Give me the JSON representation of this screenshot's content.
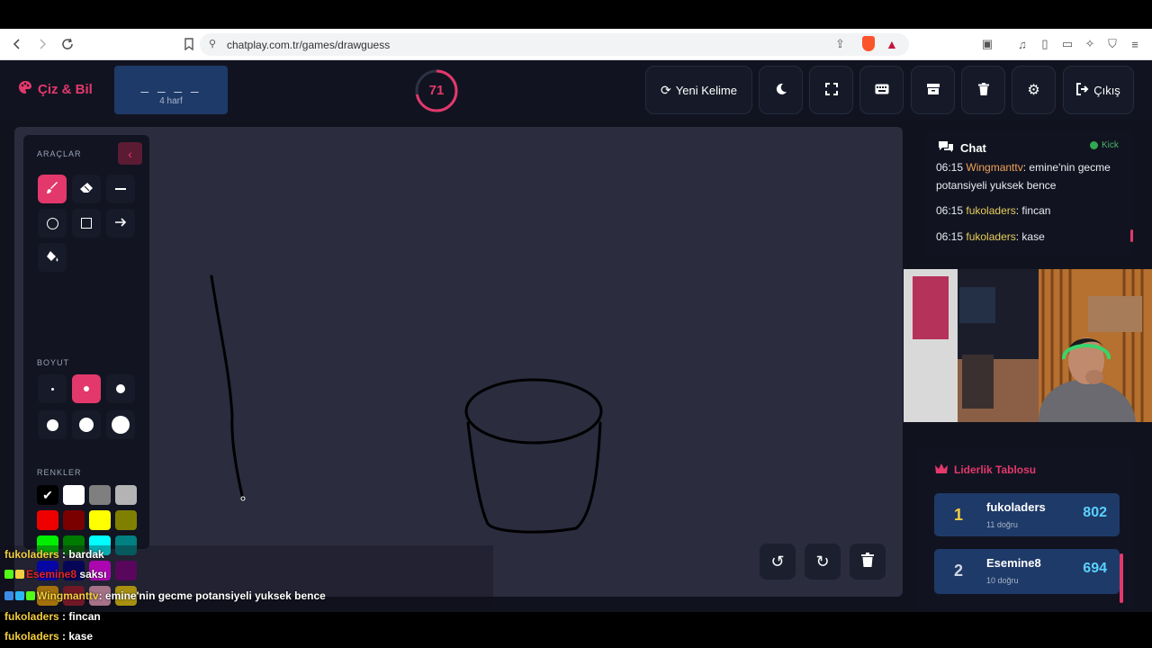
{
  "browser": {
    "url": "chatplay.com.tr/games/drawguess"
  },
  "header": {
    "brand": "Çiz & Bil",
    "word_blanks": "_ _ _ _",
    "word_hint": "4 harf",
    "timer": "71",
    "timer_progress": 0.72,
    "new_word_label": "Yeni Kelime",
    "exit_label": "Çıkış"
  },
  "tools": {
    "section_tools": "ARAÇLAR",
    "section_size": "BOYUT",
    "section_colors": "RENKLER",
    "colors": [
      "#000000",
      "#ffffff",
      "#7f7f7f",
      "#b4b4b4",
      "#ee0000",
      "#7a0000",
      "#ffff00",
      "#808000",
      "#00ee00",
      "#007a00",
      "#00ffff",
      "#008080",
      "#0000ee",
      "#00007a",
      "#ff00ff",
      "#800080",
      "#f0a500",
      "#a51d2d",
      "#f4a7c0",
      "#f7d40a"
    ]
  },
  "chat": {
    "title": "Chat",
    "platform": "Kick",
    "messages": [
      {
        "time": "06:15",
        "user": "Wingmanttv",
        "sep": ": ",
        "text": "emine'nin gecme potansiyeli yuksek bence"
      },
      {
        "time": "06:15",
        "user": "fukoladers",
        "sep": ": ",
        "text": "fincan"
      },
      {
        "time": "06:15",
        "user": "fukoladers",
        "sep": ": ",
        "text": "kase"
      }
    ]
  },
  "leaderboard": {
    "title": "Liderlik Tablosu",
    "rows": [
      {
        "rank": "1",
        "name": "fukoladers",
        "sub": "11 doğru",
        "score": "802"
      },
      {
        "rank": "2",
        "name": "Esemine8",
        "sub": "10 doğru",
        "score": "694"
      }
    ]
  },
  "overlay": {
    "lines": [
      {
        "user": "fukoladers",
        "text": ": bardak"
      },
      {
        "user": "Esemine8",
        "text": "saksı"
      },
      {
        "user": "Wingmanttv",
        "text": ": emine'nin gecme potansiyeli yuksek bence"
      },
      {
        "user": "fukoladers",
        "text": ": fincan"
      },
      {
        "user": "fukoladers",
        "text": ": kase"
      }
    ]
  },
  "accent_color": "#e3386c"
}
